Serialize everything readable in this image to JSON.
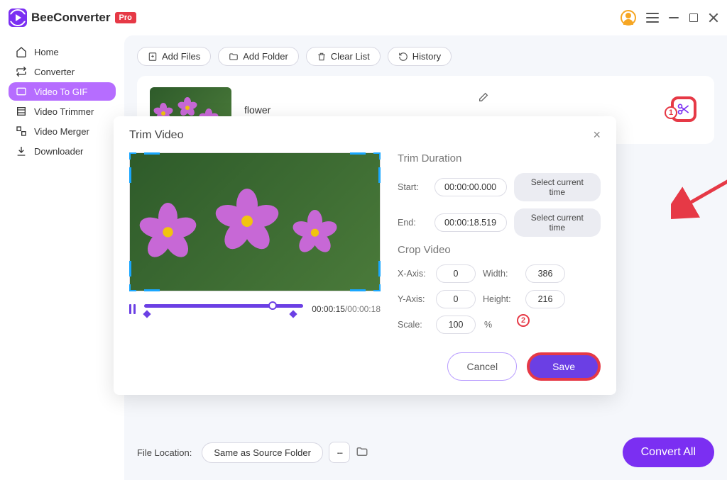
{
  "app": {
    "name": "BeeConverter",
    "badge": "Pro"
  },
  "sidebar": {
    "items": [
      {
        "label": "Home"
      },
      {
        "label": "Converter"
      },
      {
        "label": "Video To GIF"
      },
      {
        "label": "Video Trimmer"
      },
      {
        "label": "Video Merger"
      },
      {
        "label": "Downloader"
      }
    ]
  },
  "toolbar": {
    "add_files": "Add Files",
    "add_folder": "Add Folder",
    "clear_list": "Clear List",
    "history": "History"
  },
  "video": {
    "name": "flower"
  },
  "footer": {
    "label": "File Location:",
    "value": "Same as Source Folder",
    "convert": "Convert All"
  },
  "modal": {
    "title": "Trim Video",
    "time_current": "00:00:15",
    "time_total": "00:00:18",
    "trim_title": "Trim Duration",
    "start_label": "Start:",
    "start_value": "00:00:00.000",
    "end_label": "End:",
    "end_value": "00:00:18.519",
    "select_current": "Select current time",
    "crop_title": "Crop Video",
    "x_label": "X-Axis:",
    "x_value": "0",
    "width_label": "Width:",
    "width_value": "386",
    "y_label": "Y-Axis:",
    "y_value": "0",
    "height_label": "Height:",
    "height_value": "216",
    "scale_label": "Scale:",
    "scale_value": "100",
    "scale_unit": "%",
    "cancel": "Cancel",
    "save": "Save"
  },
  "anno": {
    "one": "1",
    "two": "2"
  }
}
